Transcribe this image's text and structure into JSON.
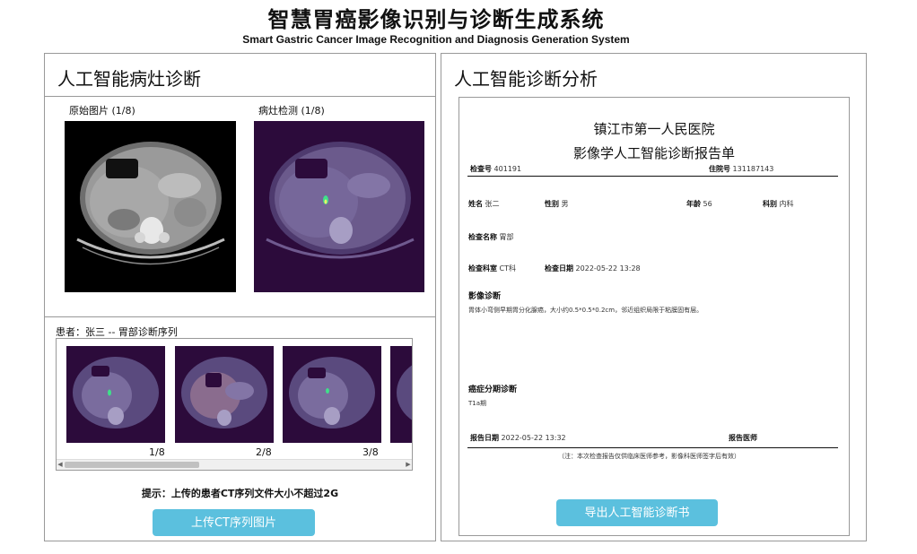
{
  "header": {
    "title": "智慧胃癌影像识别与诊断生成系统",
    "subtitle": "Smart Gastric Cancer Image Recognition and Diagnosis Generation System"
  },
  "left_panel": {
    "title": "人工智能病灶诊断",
    "original_caption": "原始图片 (1/8)",
    "detection_caption": "病灶检测 (1/8)",
    "series_caption": "患者：张三 -- 胃部诊断序列",
    "thumbnails": [
      "1/8",
      "2/8",
      "3/8"
    ],
    "hint": "提示：上传的患者CT序列文件大小不超过2G",
    "upload_button": "上传CT序列图片"
  },
  "right_panel": {
    "title": "人工智能诊断分析",
    "export_button": "导出人工智能诊断书",
    "report": {
      "hospital": "镇江市第一人民医院",
      "report_title": "影像学人工智能诊断报告单",
      "exam_no_label": "检查号",
      "exam_no": "401191",
      "admission_no_label": "住院号",
      "admission_no": "131187143",
      "name_label": "姓名",
      "name": "张二",
      "sex_label": "性别",
      "sex": "男",
      "age_label": "年龄",
      "age": "56",
      "dept_label": "科别",
      "dept": "内科",
      "exam_name_label": "检查名称",
      "exam_name": "胃部",
      "exam_room_label": "检查科室",
      "exam_room": "CT科",
      "exam_date_label": "检查日期",
      "exam_date": "2022-05-22 13:28",
      "imaging_diagnosis_label": "影像诊断",
      "imaging_diagnosis": "胃体小弯侧早期胃分化腺癌，大小约0.5*0.5*0.2cm，邻近组织局限于粘膜固有层。",
      "staging_label": "癌症分期诊断",
      "staging": "T1a期",
      "report_date_label": "报告日期",
      "report_date": "2022-05-22 13:32",
      "doctor_label": "报告医师",
      "footnote": "（注：本次检查报告仅供临床医师参考，影像科医师签字后有效）"
    }
  },
  "colors": {
    "button": "#5bc0de",
    "border": "#999999"
  }
}
